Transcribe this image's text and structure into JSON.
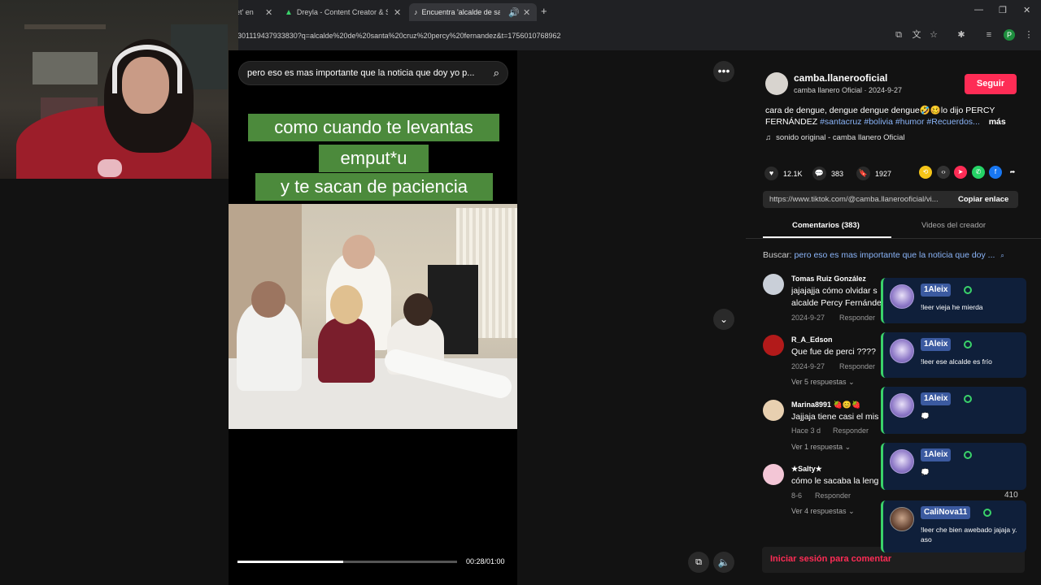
{
  "browser": {
    "tabs": [
      {
        "label": "et' en"
      },
      {
        "label": "Dreyla - Content Creator & Stre"
      },
      {
        "label": "Encuentra 'alcalde de santa"
      }
    ],
    "address": "301119437933830?q=alcalde%20de%20santa%20cruz%20percy%20fernandez&t=1756010768962",
    "profile_initial": "P"
  },
  "video": {
    "search_text": "pero eso es mas importante que la noticia que doy yo p...",
    "captions": [
      "como cuando te levantas",
      "emput*u",
      "y te sacan de paciencia"
    ],
    "time": "00:28/01:00",
    "progress": 0.48
  },
  "panel": {
    "author_name": "camba.llanerooficial",
    "author_sub": "camba llanero Oficial · 2024-9-27",
    "follow_label": "Seguir",
    "desc_text": "cara de dengue, dengue dengue dengue🤣🥴lo dijo PERCY FERNÁNDEZ ",
    "desc_hashtags": "#santacruz #bolivia #humor #Recuerdos...",
    "desc_more": "más",
    "sound": "sonido original - camba llanero Oficial",
    "likes": "12.1K",
    "comments_count": "383",
    "saves": "1927",
    "link": "https://www.tiktok.com/@camba.llanerooficial/vi...",
    "copy_link": "Copiar enlace",
    "tab_comments": "Comentarios (383)",
    "tab_videos": "Videos del creador",
    "search_label": "Buscar:",
    "search_query": "pero eso es mas importante que la noticia que doy ...",
    "login_prompt": "Iniciar sesión para comentar"
  },
  "comments": [
    {
      "user": "Tomas Ruiz González",
      "text1": "jajajajja cómo olvidar s",
      "text2": "alcalde Percy Fernánde",
      "date": "2024-9-27",
      "reply": "Responder",
      "replies": ""
    },
    {
      "user": "R_A_Edson",
      "text1": "Que fue de perci ????",
      "text2": "",
      "date": "2024-9-27",
      "reply": "Responder",
      "replies": "Ver 5 respuestas"
    },
    {
      "user": "Marina8991 🍓😊🍓",
      "text1": "Jajjaja tiene casi el mis",
      "text2": "",
      "date": "Hace 3 d",
      "reply": "Responder",
      "replies": "Ver 1 respuesta"
    },
    {
      "user": "★Salty★",
      "text1": "cómo le sacaba la leng",
      "text2": "",
      "date": "8-6",
      "reply": "Responder",
      "replies": "Ver 4 respuestas"
    }
  ],
  "chat": [
    {
      "name": "1Aleix",
      "msg": "!leer vieja he mierda"
    },
    {
      "name": "1Aleix",
      "msg": "!leer ese alcalde es frío"
    },
    {
      "name": "1Aleix",
      "msg": "💭"
    },
    {
      "name": "1Aleix",
      "msg": "💭"
    },
    {
      "name": "CaliNova11",
      "msg": "!leer che bien awebado jajaja y. aso"
    }
  ],
  "viewers": "410",
  "colors": {
    "accent": "#fe2c55",
    "caption_bg": "#4c8a3c",
    "chat_bg": "#0f1f3a",
    "link_blue": "#8ab4f8"
  }
}
